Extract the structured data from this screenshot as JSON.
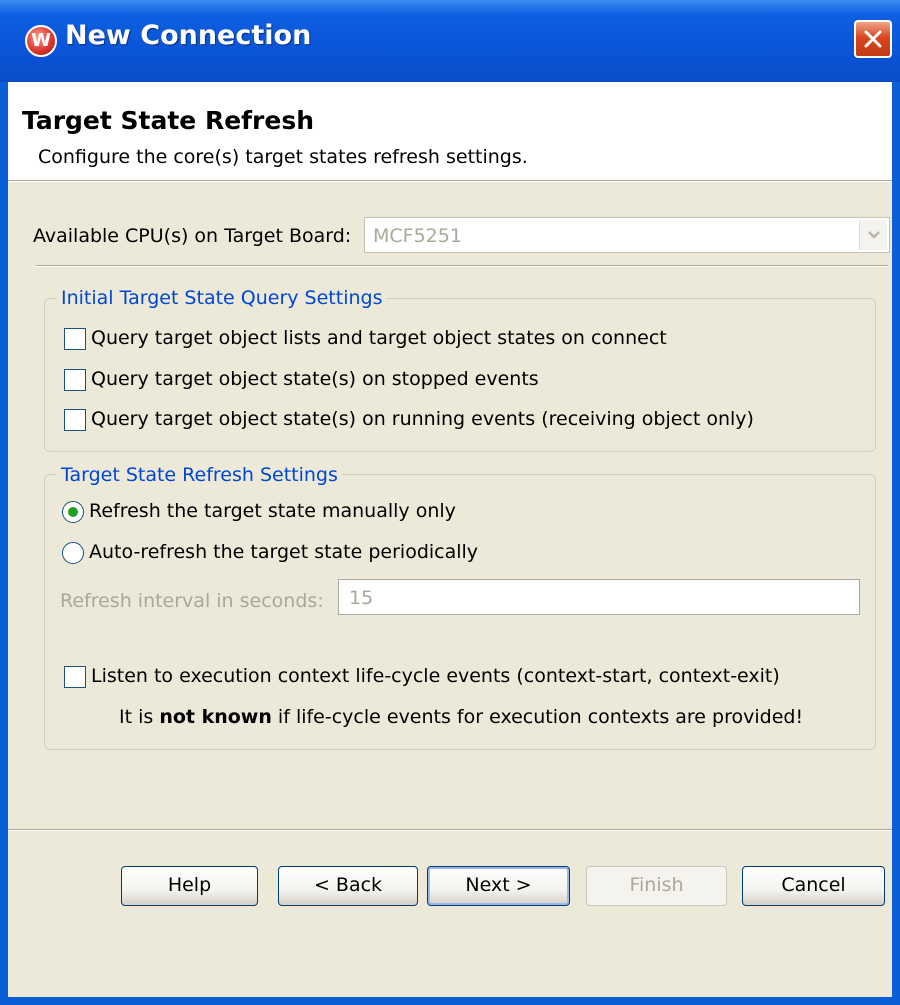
{
  "window": {
    "title": "New Connection",
    "icon_letter": "W"
  },
  "header": {
    "title": "Target State Refresh",
    "description": "Configure the core(s) target states refresh settings."
  },
  "cpu": {
    "label": "Available CPU(s) on Target Board:",
    "value": "MCF5251"
  },
  "query_group": {
    "title": "Initial Target State Query Settings",
    "items": [
      {
        "label": "Query target object lists and target object states on connect",
        "checked": false
      },
      {
        "label": "Query target object state(s) on stopped events",
        "checked": false
      },
      {
        "label": "Query target object state(s) on running events (receiving object only)",
        "checked": false
      }
    ]
  },
  "refresh_group": {
    "title": "Target State Refresh Settings",
    "options": [
      {
        "label": "Refresh the target state manually only",
        "selected": true
      },
      {
        "label": "Auto-refresh the target state periodically",
        "selected": false
      }
    ],
    "interval_label": "Refresh interval in seconds:",
    "interval_value": "15",
    "listen_label": "Listen to execution context life-cycle events (context-start, context-exit)",
    "listen_checked": false,
    "note_prefix": "It is ",
    "note_bold": "not known",
    "note_suffix": " if life-cycle events for execution contexts are provided!"
  },
  "buttons": {
    "help": "Help",
    "back": "< Back",
    "next": "Next >",
    "finish": "Finish",
    "cancel": "Cancel"
  },
  "colors": {
    "titlebar": "#0a55d8",
    "client": "#ece9d8",
    "group_label": "#0046d5",
    "close": "#d9461f",
    "radio_dot": "#21a121"
  }
}
